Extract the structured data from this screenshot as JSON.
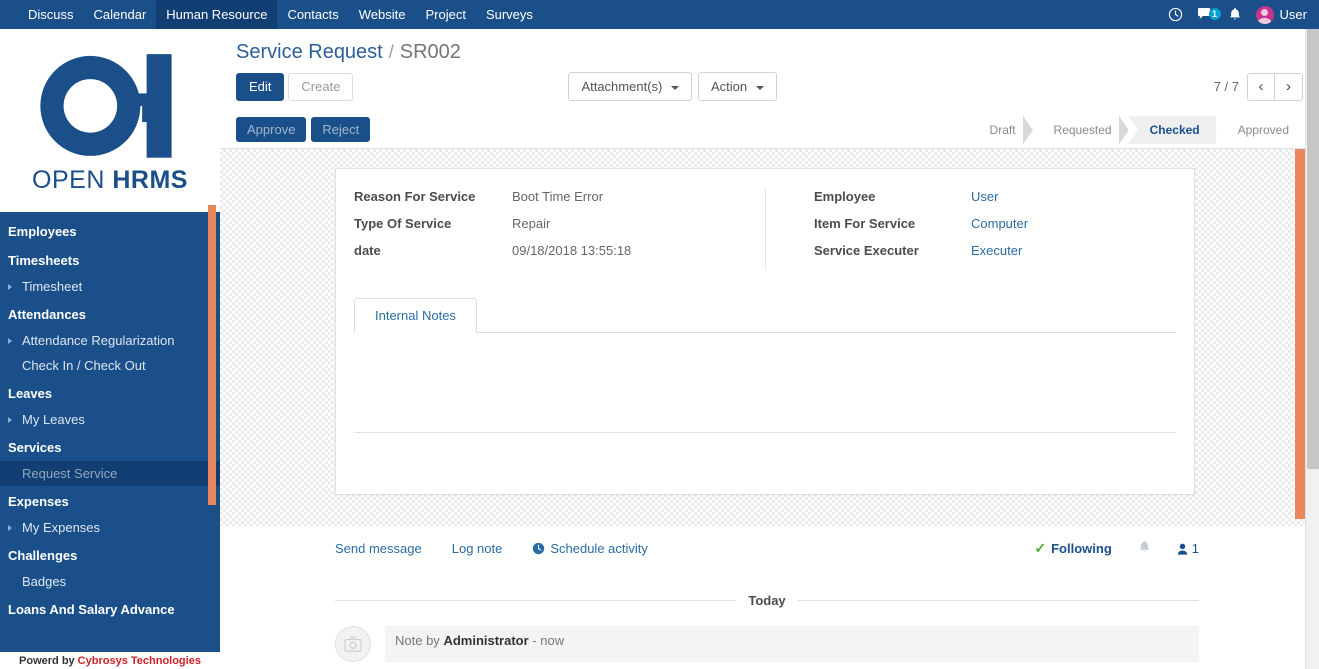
{
  "navbar": {
    "menus": [
      {
        "label": "Discuss",
        "active": false
      },
      {
        "label": "Calendar",
        "active": false
      },
      {
        "label": "Human Resource",
        "active": true
      },
      {
        "label": "Contacts",
        "active": false
      },
      {
        "label": "Website",
        "active": false
      },
      {
        "label": "Project",
        "active": false
      },
      {
        "label": "Surveys",
        "active": false
      }
    ],
    "icons": [
      "clock-icon",
      "messages-icon",
      "bell-icon"
    ],
    "message_badge": "1",
    "user_name": "User"
  },
  "sidebar": {
    "logo": {
      "text_thin": "OPEN",
      "text_bold": "HRMS"
    },
    "groups": [
      {
        "header": "Employees",
        "items": []
      },
      {
        "header": "Timesheets",
        "items": [
          {
            "label": "Timesheet",
            "caret": true,
            "active": false
          }
        ]
      },
      {
        "header": "Attendances",
        "items": [
          {
            "label": "Attendance Regularization",
            "caret": true,
            "active": false
          },
          {
            "label": "Check In / Check Out",
            "caret": false,
            "active": false
          }
        ]
      },
      {
        "header": "Leaves",
        "items": [
          {
            "label": "My Leaves",
            "caret": true,
            "active": false
          }
        ]
      },
      {
        "header": "Services",
        "items": [
          {
            "label": "Request Service",
            "caret": false,
            "active": true
          }
        ]
      },
      {
        "header": "Expenses",
        "items": [
          {
            "label": "My Expenses",
            "caret": true,
            "active": false
          }
        ]
      },
      {
        "header": "Challenges",
        "items": [
          {
            "label": "Badges",
            "caret": false,
            "active": false
          }
        ]
      },
      {
        "header": "Loans And Salary Advance",
        "items": []
      }
    ],
    "footer_prefix": "Powerd by",
    "footer_brand": "Cybrosys Technologies"
  },
  "control_panel": {
    "breadcrumb_root": "Service Request",
    "breadcrumb_sep": "/",
    "breadcrumb_current": "SR002",
    "edit_label": "Edit",
    "create_label": "Create",
    "attachments_label": "Attachment(s)",
    "action_label": "Action",
    "pager_text": "7 / 7",
    "prev_icon": "chevron-left-icon",
    "next_icon": "chevron-right-icon"
  },
  "status_row": {
    "approve_label": "Approve",
    "reject_label": "Reject",
    "stages": [
      {
        "label": "Draft",
        "active": false
      },
      {
        "label": "Requested",
        "active": false
      },
      {
        "label": "Checked",
        "active": true
      },
      {
        "label": "Approved",
        "active": false
      }
    ]
  },
  "form": {
    "left": [
      {
        "label": "Reason For Service",
        "value": "Boot Time Error",
        "link": false
      },
      {
        "label": "Type Of Service",
        "value": "Repair",
        "link": false
      },
      {
        "label": "date",
        "value": "09/18/2018 13:55:18",
        "link": false
      }
    ],
    "right": [
      {
        "label": "Employee",
        "value": "User",
        "link": true
      },
      {
        "label": "Item For Service",
        "value": "Computer",
        "link": true
      },
      {
        "label": "Service Executer",
        "value": "Executer",
        "link": true
      }
    ],
    "tabs": [
      {
        "label": "Internal Notes",
        "active": true
      }
    ],
    "notes_value": ""
  },
  "chatter": {
    "send_message_label": "Send message",
    "log_note_label": "Log note",
    "schedule_activity_label": "Schedule activity",
    "schedule_icon": "clock-icon",
    "following_label": "Following",
    "following_check_icon": "check-icon",
    "bell_icon": "bell-icon",
    "followers_icon": "user-icon",
    "followers_count": "1",
    "day_separator": "Today",
    "messages": [
      {
        "prefix": "Note by",
        "author": "Administrator",
        "suffix": "- now"
      }
    ]
  },
  "colors": {
    "brand_blue": "#1b4f8a",
    "accent_orange": "#e8865c",
    "link_blue": "#2b6ca3",
    "footer_red": "#cc2229",
    "badge_cyan": "#00a0d2"
  }
}
